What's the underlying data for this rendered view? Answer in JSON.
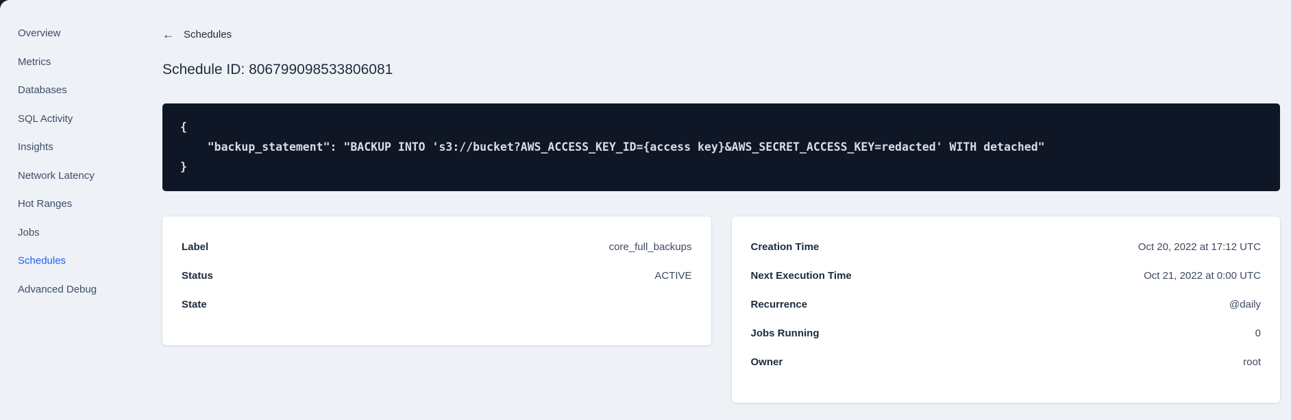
{
  "sidebar": {
    "items": [
      {
        "label": "Overview",
        "active": false
      },
      {
        "label": "Metrics",
        "active": false
      },
      {
        "label": "Databases",
        "active": false
      },
      {
        "label": "SQL Activity",
        "active": false
      },
      {
        "label": "Insights",
        "active": false
      },
      {
        "label": "Network Latency",
        "active": false
      },
      {
        "label": "Hot Ranges",
        "active": false
      },
      {
        "label": "Jobs",
        "active": false
      },
      {
        "label": "Schedules",
        "active": true
      },
      {
        "label": "Advanced Debug",
        "active": false
      }
    ]
  },
  "header": {
    "back_arrow": "←",
    "back_label": "Schedules",
    "title": "Schedule ID: 806799098533806081"
  },
  "code_block": {
    "lines": [
      "{",
      "    \"backup_statement\": \"BACKUP INTO 's3://bucket?AWS_ACCESS_KEY_ID={access key}&AWS_SECRET_ACCESS_KEY=redacted' WITH detached\"",
      "}"
    ]
  },
  "details_card": {
    "rows": [
      {
        "label": "Label",
        "value": "core_full_backups"
      },
      {
        "label": "Status",
        "value": "ACTIVE"
      },
      {
        "label": "State",
        "value": ""
      }
    ]
  },
  "schedule_card": {
    "rows": [
      {
        "label": "Creation Time",
        "value": "Oct 20, 2022 at 17:12 UTC"
      },
      {
        "label": "Next Execution Time",
        "value": "Oct 21, 2022 at 0:00 UTC"
      },
      {
        "label": "Recurrence",
        "value": "@daily"
      },
      {
        "label": "Jobs Running",
        "value": "0"
      },
      {
        "label": "Owner",
        "value": "root"
      }
    ]
  },
  "colors": {
    "accent_blue": "#1e5ff5",
    "page_background": "#eef2f7",
    "code_background": "#0f1626",
    "code_text": "#d8dee8"
  }
}
